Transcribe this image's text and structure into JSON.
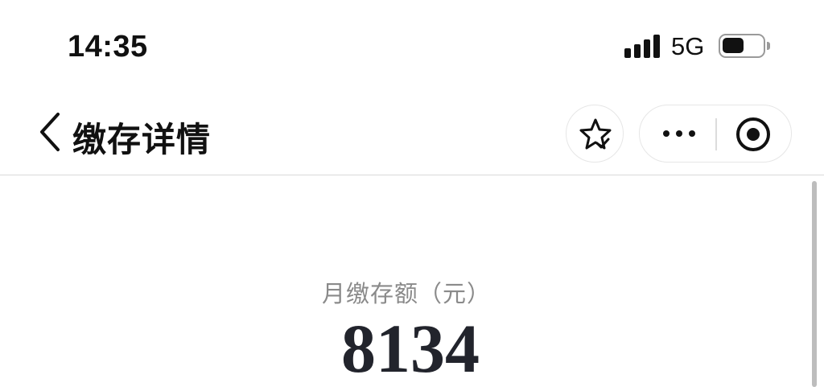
{
  "status_bar": {
    "time": "14:35",
    "network": "5G",
    "signal_bars": 4,
    "battery_level": 0.55,
    "icons": [
      "signal-icon",
      "battery-icon"
    ]
  },
  "nav": {
    "title": "缴存详情",
    "icons": {
      "back": "chevron-left-icon",
      "favorite": "star-check-icon",
      "more": "more-dots-icon",
      "close": "target-close-icon"
    }
  },
  "summary": {
    "label": "月缴存额（元）",
    "value": "8134"
  },
  "colors": {
    "background": "#ffffff",
    "text_primary": "#111111",
    "text_secondary": "#8a8a8a",
    "amount": "#22242c",
    "divider": "#d9d9d9"
  }
}
